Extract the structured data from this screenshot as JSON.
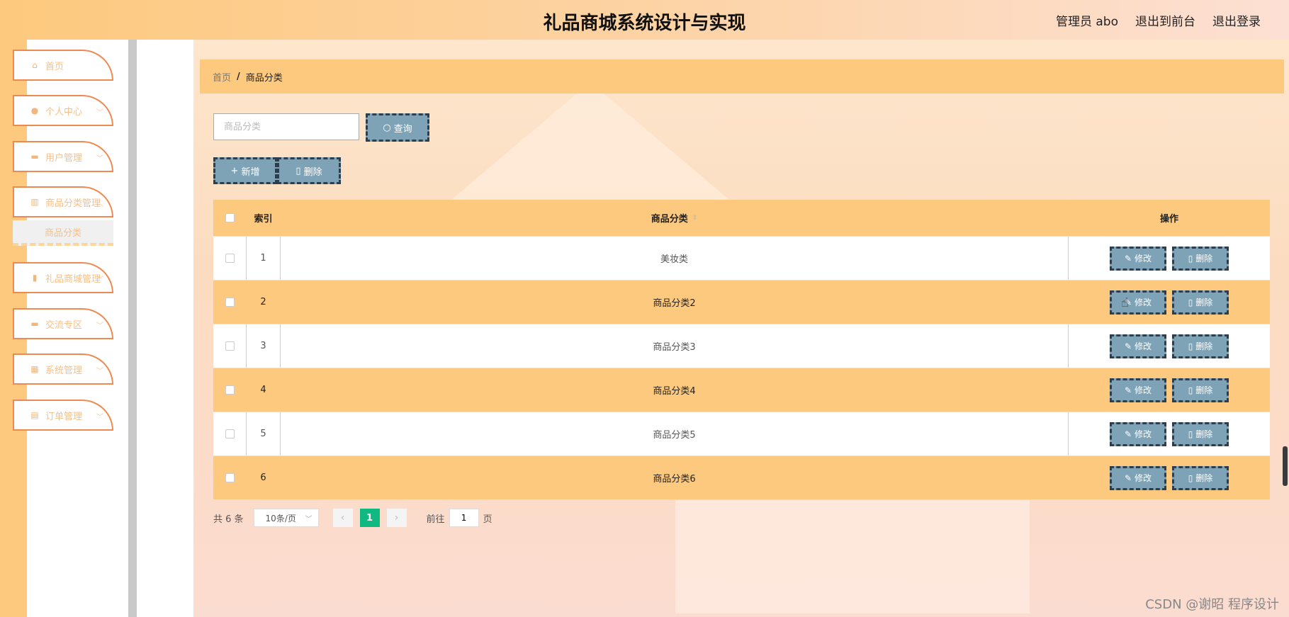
{
  "header": {
    "title": "礼品商城系统设计与实现",
    "admin": "管理员 abo",
    "to_front": "退出到前台",
    "logout": "退出登录"
  },
  "sidebar": {
    "items": [
      {
        "label": "首页",
        "icon": "home-icon"
      },
      {
        "label": "个人中心",
        "icon": "user-icon"
      },
      {
        "label": "用户管理",
        "icon": "monitor-icon"
      },
      {
        "label": "商品分类管理",
        "icon": "bar-icon"
      },
      {
        "label": "礼品商城管理",
        "icon": "chart-icon"
      },
      {
        "label": "交流专区",
        "icon": "monitor-icon"
      },
      {
        "label": "系统管理",
        "icon": "grid-icon"
      },
      {
        "label": "订单管理",
        "icon": "clipboard-icon"
      }
    ],
    "submenu_label": "商品分类"
  },
  "breadcrumb": {
    "home": "首页",
    "sep": "/",
    "current": "商品分类"
  },
  "search": {
    "placeholder": "商品分类",
    "button": "查询"
  },
  "actions": {
    "add": "新增",
    "delete": "删除"
  },
  "table": {
    "headers": {
      "index": "索引",
      "name": "商品分类",
      "ops": "操作"
    },
    "rows": [
      {
        "index": "1",
        "name": "美妆类"
      },
      {
        "index": "2",
        "name": "商品分类2"
      },
      {
        "index": "3",
        "name": "商品分类3"
      },
      {
        "index": "4",
        "name": "商品分类4"
      },
      {
        "index": "5",
        "name": "商品分类5"
      },
      {
        "index": "6",
        "name": "商品分类6"
      }
    ],
    "edit_label": "修改",
    "delete_label": "删除"
  },
  "pager": {
    "total": "共 6 条",
    "size": "10条/页",
    "current_page": "1",
    "goto_label": "前往",
    "goto_value": "1",
    "page_unit": "页"
  },
  "watermark": "CSDN @谢昭 程序设计"
}
